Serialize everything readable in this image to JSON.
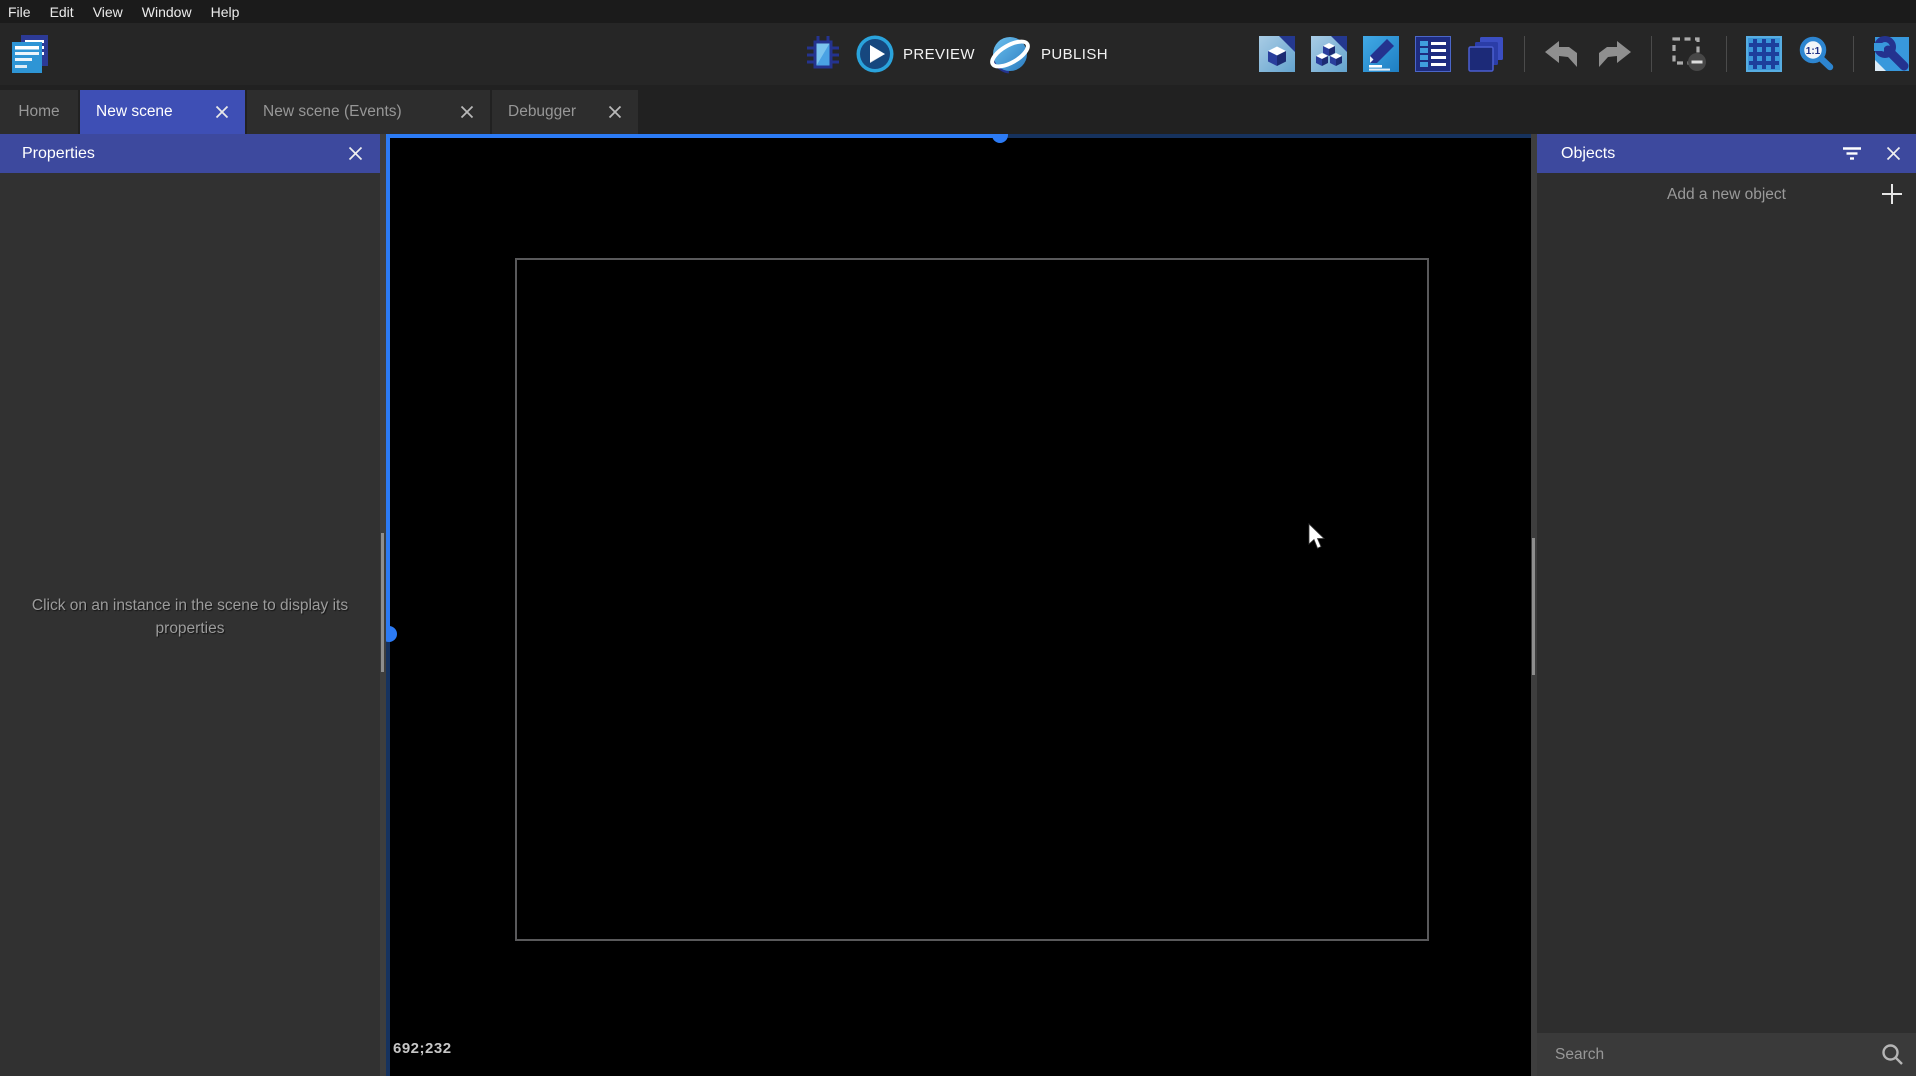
{
  "menu": {
    "items": [
      "File",
      "Edit",
      "View",
      "Window",
      "Help"
    ]
  },
  "toolbar": {
    "preview_label": "PREVIEW",
    "publish_label": "PUBLISH",
    "icon_names": [
      "project-manager-icon",
      "debug-icon",
      "preview-play-icon",
      "publish-globe-icon",
      "scene-cube-page-icon",
      "objects-cubes-icon",
      "pencil-edit-icon",
      "list-properties-icon",
      "layers-icon",
      "undo-icon",
      "redo-icon",
      "deselect-icon",
      "grid-icon",
      "zoom-1-1-icon",
      "wrench-file-icon"
    ]
  },
  "tabs": {
    "items": [
      {
        "label": "Home",
        "active": false,
        "closable": false
      },
      {
        "label": "New scene",
        "active": true,
        "closable": true
      },
      {
        "label": "New scene (Events)",
        "active": false,
        "closable": true
      },
      {
        "label": "Debugger",
        "active": false,
        "closable": true
      }
    ]
  },
  "panels": {
    "properties": {
      "title": "Properties",
      "empty_message": "Click on an instance in the scene to display its properties"
    },
    "objects": {
      "title": "Objects",
      "add_button_label": "Add a new object",
      "search_placeholder": "Search"
    }
  },
  "canvas": {
    "status_coordinates": "692;232"
  },
  "colors": {
    "active_tab_blue": "#3e4fb5",
    "panel_header_blue": "#3d499e",
    "scrollbar_blue": "#2c7bf5",
    "scrollbar_track_dark": "#16325e",
    "toolbar_bg": "#262626",
    "panel_bg": "#313131",
    "canvas_bg": "#000000",
    "icon_navy": "#24338f",
    "icon_light_blue": "#3a97da"
  }
}
